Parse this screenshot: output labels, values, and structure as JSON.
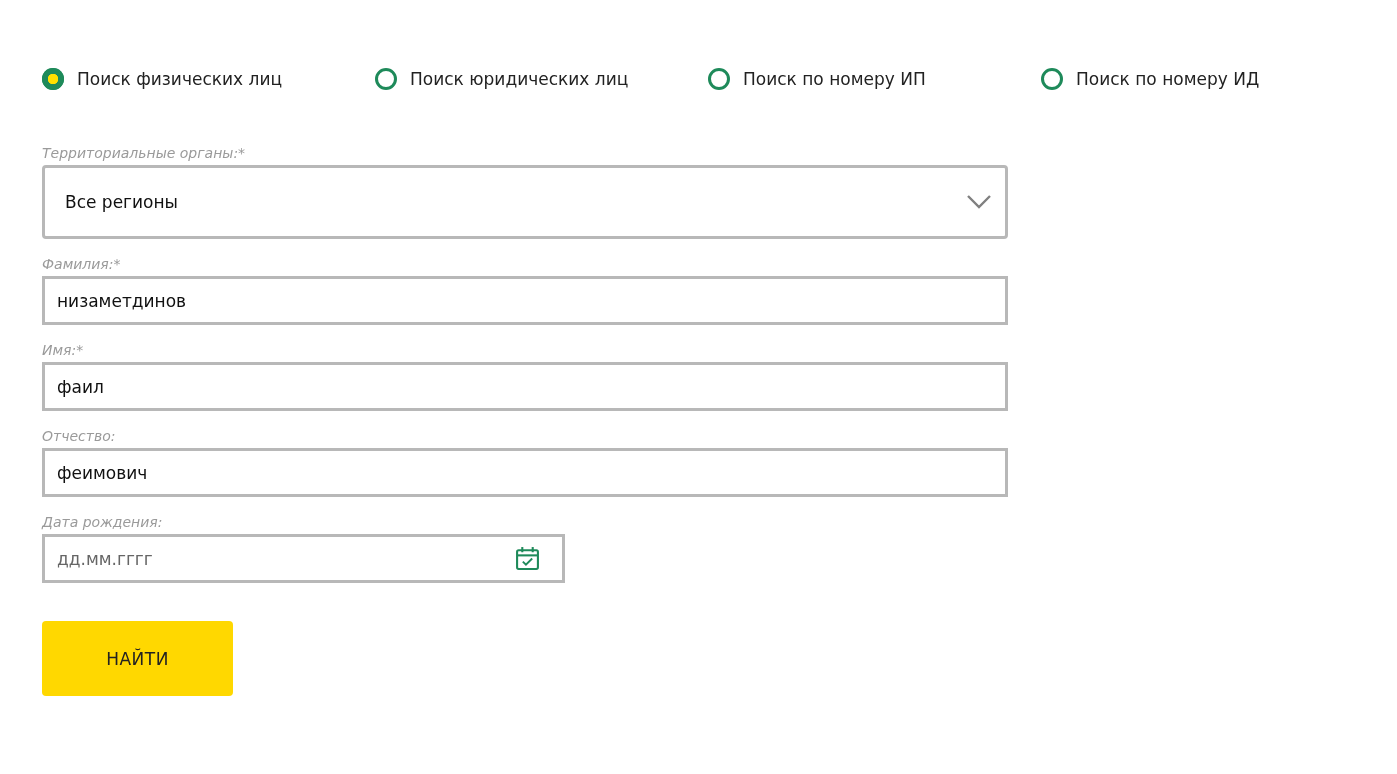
{
  "search_types": [
    {
      "label": "Поиск физических лиц",
      "selected": true
    },
    {
      "label": "Поиск юридических лиц",
      "selected": false
    },
    {
      "label": "Поиск по номеру ИП",
      "selected": false
    },
    {
      "label": "Поиск по номеру ИД",
      "selected": false
    }
  ],
  "fields": [
    {
      "kind": "select",
      "label": "Территориальные органы:*",
      "value": "Все регионы"
    },
    {
      "kind": "text",
      "label": "Фамилия:*",
      "value": "низаметдинов"
    },
    {
      "kind": "text",
      "label": "Имя:*",
      "value": "фаил"
    },
    {
      "kind": "text",
      "label": "Отчество:",
      "value": "феимович"
    },
    {
      "kind": "date",
      "label": "Дата рождения:",
      "placeholder": "дд.мм.гггг"
    }
  ],
  "submit_button": "НАЙТИ"
}
